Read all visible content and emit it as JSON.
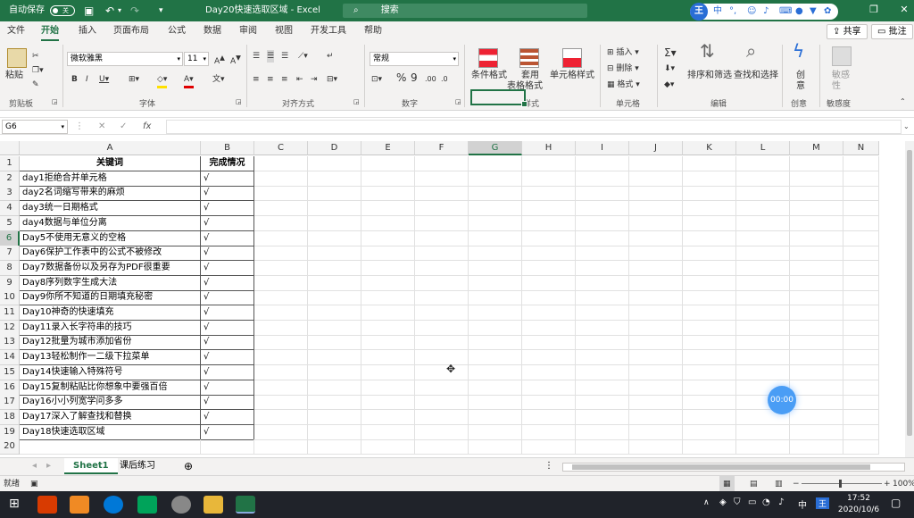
{
  "titlebar": {
    "autosave_label": "自动保存",
    "autosave_state": "关",
    "doc_title": "Day20快速选取区域",
    "app_name": "Excel",
    "search_placeholder": "搜索",
    "ime_badge": "王",
    "ime_lang": "中"
  },
  "tabs": [
    "文件",
    "开始",
    "插入",
    "页面布局",
    "公式",
    "数据",
    "审阅",
    "视图",
    "开发工具",
    "帮助"
  ],
  "share_label": "共享",
  "comment_label": "批注",
  "ribbon": {
    "clipboard": {
      "paste": "粘贴",
      "group": "剪贴板"
    },
    "font": {
      "name": "微软雅黑",
      "size": "11",
      "group": "字体"
    },
    "alignment": {
      "group": "对齐方式"
    },
    "number": {
      "format": "常规",
      "group": "数字"
    },
    "styles": {
      "conditional": "条件格式",
      "table_line1": "套用",
      "table_line2": "表格格式",
      "cell_styles": "单元格样式",
      "group": "样式"
    },
    "cells": {
      "insert": "插入",
      "delete": "删除",
      "format": "格式",
      "group": "单元格"
    },
    "editing": {
      "sort": "排序和筛选",
      "find": "查找和选择",
      "group": "编辑"
    },
    "creative": {
      "line1": "创",
      "line2": "意",
      "group": "创意"
    },
    "sensitivity": {
      "line1": "敏感",
      "line2": "性",
      "group": "敏感度"
    }
  },
  "formula_bar": {
    "name_box": "G6",
    "fx": "fx",
    "value": ""
  },
  "columns": [
    "A",
    "B",
    "C",
    "D",
    "E",
    "F",
    "G",
    "H",
    "I",
    "J",
    "K",
    "L",
    "M",
    "N"
  ],
  "selected_cell": "G6",
  "headers": {
    "a": "关键词",
    "b": "完成情况"
  },
  "rows": [
    {
      "n": "2",
      "a": "day1拒绝合并单元格",
      "b": "√"
    },
    {
      "n": "3",
      "a": "day2名词缩写带来的麻烦",
      "b": "√"
    },
    {
      "n": "4",
      "a": "day3统一日期格式",
      "b": "√"
    },
    {
      "n": "5",
      "a": "day4数据与单位分离",
      "b": "√"
    },
    {
      "n": "6",
      "a": "Day5不使用无意义的空格",
      "b": "√"
    },
    {
      "n": "7",
      "a": "Day6保护工作表中的公式不被修改",
      "b": "√"
    },
    {
      "n": "8",
      "a": "Day7数据备份以及另存为PDF很重要",
      "b": "√"
    },
    {
      "n": "9",
      "a": "Day8序列数字生成大法",
      "b": "√"
    },
    {
      "n": "10",
      "a": "Day9你所不知道的日期填充秘密",
      "b": "√"
    },
    {
      "n": "11",
      "a": "Day10神奇的快速填充",
      "b": "√"
    },
    {
      "n": "12",
      "a": "Day11录入长字符串的技巧",
      "b": "√"
    },
    {
      "n": "13",
      "a": "Day12批量为城市添加省份",
      "b": "√"
    },
    {
      "n": "14",
      "a": "Day13轻松制作一二级下拉菜单",
      "b": "√"
    },
    {
      "n": "15",
      "a": "Day14快速输入特殊符号",
      "b": "√"
    },
    {
      "n": "16",
      "a": "Day15复制粘贴比你想象中要强百倍",
      "b": "√"
    },
    {
      "n": "17",
      "a": "Day16小小列宽学问多多",
      "b": "√"
    },
    {
      "n": "18",
      "a": "Day17深入了解查找和替换",
      "b": "√"
    },
    {
      "n": "19",
      "a": "Day18快速选取区域",
      "b": "√"
    }
  ],
  "extra_row": "20",
  "header_row": "1",
  "sheets": [
    {
      "name": "Sheet1",
      "active": true
    },
    {
      "name": "课后练习",
      "active": false
    }
  ],
  "status": {
    "ready": "就绪",
    "zoom": "100%"
  },
  "timer": "00:00",
  "taskbar": {
    "time": "17:52",
    "date": "2020/10/6",
    "ime": "中",
    "ime_badge": "王"
  },
  "colors": {
    "excel_green": "#217346",
    "taskbar": "#20232a",
    "timer_blue": "#4a9df5"
  }
}
